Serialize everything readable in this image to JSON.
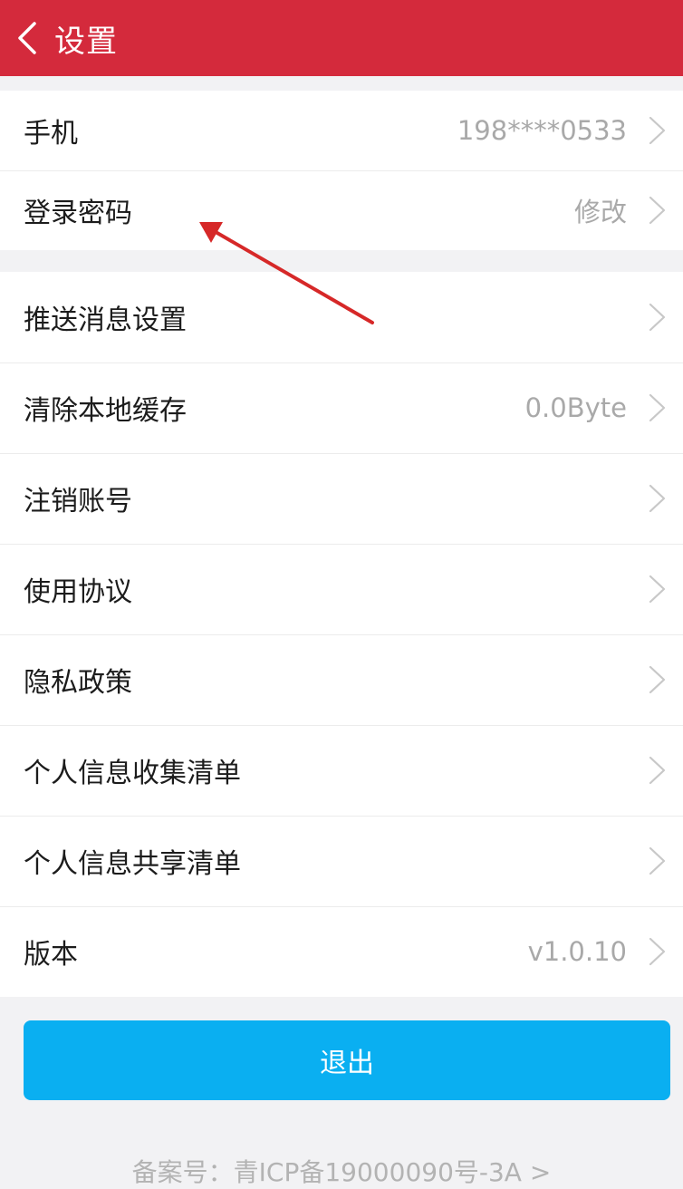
{
  "colors": {
    "brand": "#d42a3c",
    "accent": "#0aaff1",
    "annotation": "#d62828"
  },
  "header": {
    "back_icon": "chevron-left-icon",
    "title": "设置"
  },
  "account_group": [
    {
      "label": "手机",
      "value": "198****0533"
    },
    {
      "label": "登录密码",
      "value": "修改"
    }
  ],
  "settings_group": [
    {
      "label": "推送消息设置",
      "value": ""
    },
    {
      "label": "清除本地缓存",
      "value": "0.0Byte"
    },
    {
      "label": "注销账号",
      "value": ""
    },
    {
      "label": "使用协议",
      "value": ""
    },
    {
      "label": "隐私政策",
      "value": ""
    },
    {
      "label": "个人信息收集清单",
      "value": ""
    },
    {
      "label": "个人信息共享清单",
      "value": ""
    },
    {
      "label": "版本",
      "value": "v1.0.10"
    }
  ],
  "logout_label": "退出",
  "footer": {
    "icp": "备案号：青ICP备19000090号-3A >"
  }
}
